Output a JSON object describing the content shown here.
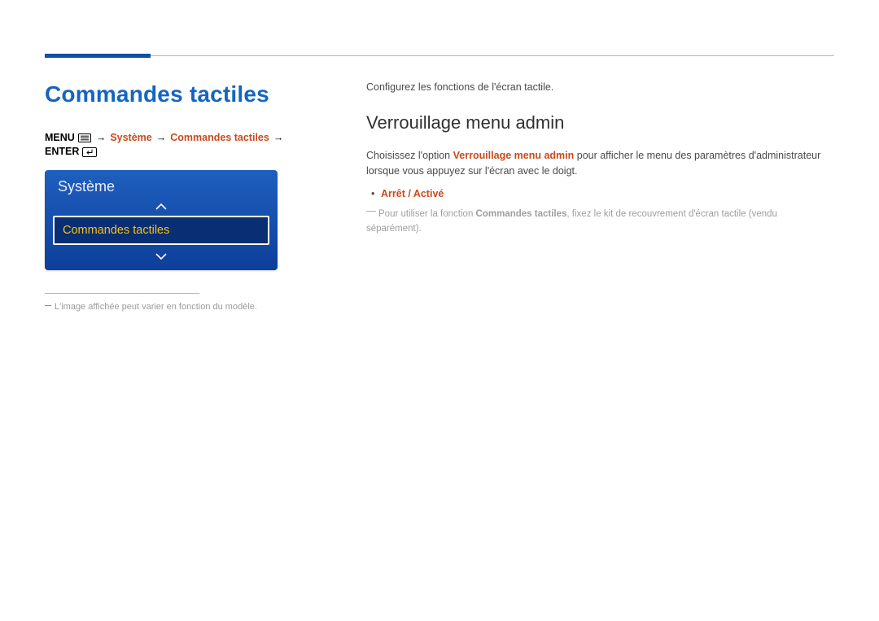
{
  "page": {
    "title": "Commandes tactiles"
  },
  "breadcrumb": {
    "menu_label": "MENU",
    "arrow": "→",
    "item1": "Système",
    "item2": "Commandes tactiles",
    "enter_label": "ENTER"
  },
  "osd": {
    "header": "Système",
    "selected": "Commandes tactiles"
  },
  "footnote": {
    "text": "L'image affichée peut varier en fonction du modèle."
  },
  "right": {
    "intro": "Configurez les fonctions de l'écran tactile.",
    "sub_heading": "Verrouillage menu admin",
    "desc_pre": "Choisissez l'option ",
    "desc_strong": "Verrouillage menu admin",
    "desc_post": " pour afficher le menu des paramètres d'administrateur lorsque vous appuyez sur l'écran avec le doigt.",
    "option_values": "Arrêt / Activé",
    "note_pre": "Pour utiliser la fonction ",
    "note_strong": "Commandes tactiles",
    "note_post": ", fixez le kit de recouvrement d'écran tactile (vendu séparément)."
  }
}
